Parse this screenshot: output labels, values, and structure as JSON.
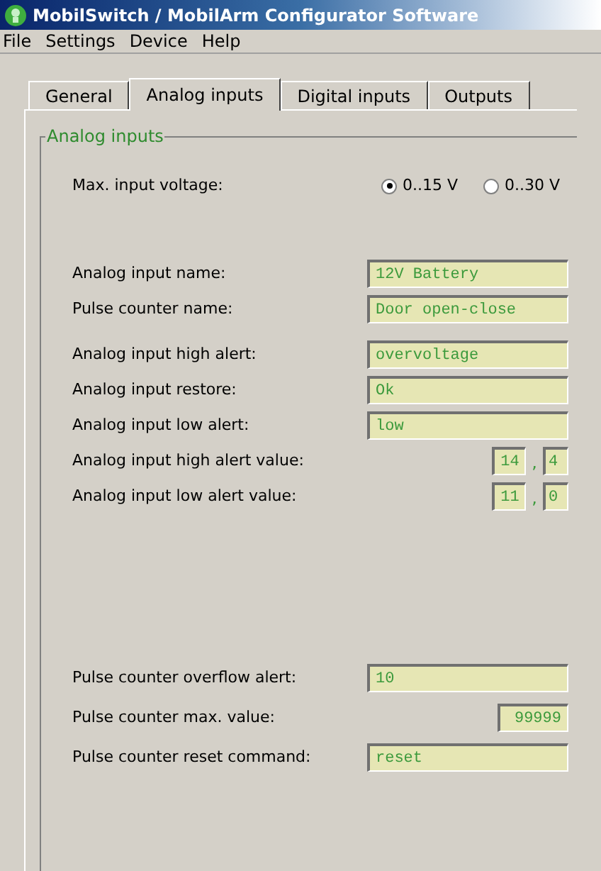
{
  "window": {
    "title": "MobilSwitch / MobilArm Configurator Software"
  },
  "menu": [
    "File",
    "Settings",
    "Device",
    "Help"
  ],
  "tabs": [
    {
      "label": "General",
      "selected": false
    },
    {
      "label": "Analog inputs",
      "selected": true
    },
    {
      "label": "Digital inputs",
      "selected": false
    },
    {
      "label": "Outputs",
      "selected": false
    }
  ],
  "group": {
    "title": "Analog inputs"
  },
  "voltage": {
    "label": "Max. input voltage:",
    "options": [
      {
        "label": "0..15 V",
        "selected": true
      },
      {
        "label": "0..30 V",
        "selected": false
      }
    ]
  },
  "sections": [
    [
      {
        "kind": "text",
        "label": "Analog input name:",
        "value": "12V Battery"
      },
      {
        "kind": "text",
        "label": "Pulse counter name:",
        "value": "Door open-close"
      }
    ],
    [
      {
        "kind": "text",
        "label": "Analog input high alert:",
        "value": "overvoltage"
      },
      {
        "kind": "text",
        "label": "Analog input restore:",
        "value": "Ok"
      },
      {
        "kind": "text",
        "label": "Analog input low alert:",
        "value": "low"
      },
      {
        "kind": "split",
        "label": "Analog input high alert value:",
        "whole": "14",
        "separator": ",",
        "fraction": "4"
      },
      {
        "kind": "split",
        "label": "Analog input low alert value:",
        "whole": "11",
        "separator": ",",
        "fraction": "0"
      }
    ],
    [
      {
        "kind": "text",
        "label": "Pulse counter overflow alert:",
        "value": "10"
      },
      {
        "kind": "number",
        "label": "Pulse counter max. value:",
        "value": "99999"
      },
      {
        "kind": "text",
        "label": "Pulse counter reset command:",
        "value": "reset"
      }
    ]
  ]
}
